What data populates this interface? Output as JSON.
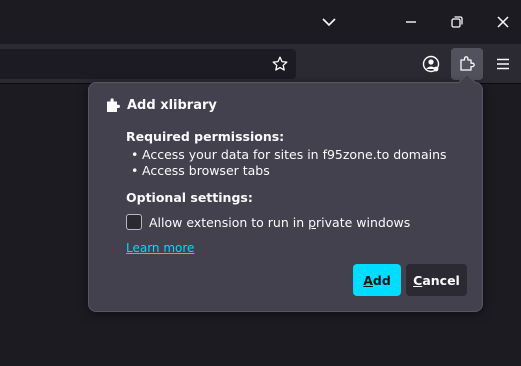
{
  "window": {
    "controls": [
      "list-tabs",
      "minimize",
      "restore",
      "close"
    ]
  },
  "toolbar": {
    "icons": [
      "star-icon",
      "account-icon",
      "extensions-icon",
      "menu-icon"
    ]
  },
  "panel": {
    "title": "Add xlibrary",
    "required_heading": "Required permissions:",
    "permissions": [
      "Access your data for sites in f95zone.to domains",
      "Access browser tabs"
    ],
    "optional_heading": "Optional settings:",
    "checkbox": {
      "label_pre": "Allow extension to run in ",
      "label_key": "p",
      "label_post": "rivate windows",
      "checked": false
    },
    "learn_more": "Learn more",
    "add_button": {
      "key": "A",
      "rest": "dd"
    },
    "cancel_button": {
      "key": "C",
      "rest": "ancel"
    }
  },
  "colors": {
    "accent": "#00ddff",
    "panel_bg": "#42414d",
    "toolbar_bg": "#2b2a33",
    "page_bg": "#1c1b22"
  }
}
